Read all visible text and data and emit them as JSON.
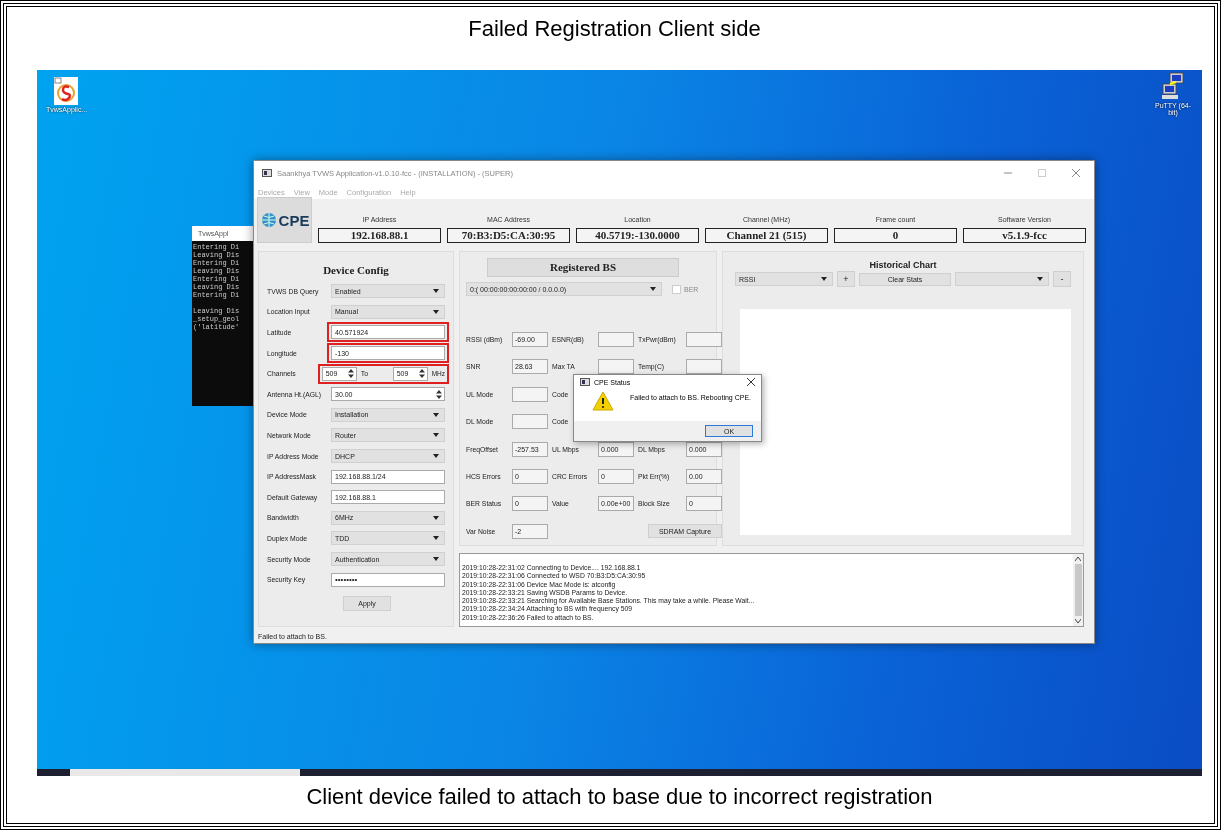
{
  "slide_title": "Failed Registration Client side",
  "caption": "Client device failed to attach to base due to incorrect registration",
  "desktop_icons": [
    {
      "kind": "app",
      "label": "TvwsApplic..."
    },
    {
      "kind": "putty",
      "label": "PuTTY (64-bit)"
    }
  ],
  "console": {
    "title": "TvwsAppl",
    "blocks": [
      [
        "Entering Di",
        "Leaving Dis",
        "Entering Di",
        "Leaving Dis",
        "Entering Di",
        "Leaving Dis",
        "Entering Di"
      ],
      [
        "Leaving Dis",
        "_setup_geol",
        "('latitude'"
      ]
    ]
  },
  "window": {
    "title": "Saankhya TVWS Application-v1.0.10-fcc - (INSTALLATION) - (SUPER)",
    "menu": [
      {
        "label": "Devices",
        "disabled": true
      },
      {
        "label": "View",
        "disabled": true
      },
      {
        "label": "Mode",
        "disabled": true
      },
      {
        "label": "Configuration",
        "disabled": true
      },
      {
        "label": "Help",
        "disabled": true
      }
    ],
    "logo_text": "CPE",
    "info": [
      {
        "label": "IP Address",
        "value": "192.168.88.1"
      },
      {
        "label": "MAC Address",
        "value": "70:B3:D5:CA:30:95"
      },
      {
        "label": "Location",
        "value": "40.5719:-130.0000"
      },
      {
        "label": "Channel (MHz)",
        "value": "Channel 21 (515)"
      },
      {
        "label": "Frame count",
        "value": "0"
      },
      {
        "label": "Software Version",
        "value": "v5.1.9-fcc"
      }
    ],
    "device_config": {
      "title": "Device Config",
      "rows": [
        {
          "kind": "select",
          "label": "TVWS DB Query",
          "value": "Enabled",
          "highlighted": false
        },
        {
          "kind": "select",
          "label": "Location Input",
          "value": "Manual",
          "highlighted": false
        },
        {
          "kind": "text",
          "label": "Latitude",
          "value": "40.571924",
          "highlighted": true
        },
        {
          "kind": "text",
          "label": "Longitude",
          "value": "-130",
          "highlighted": true
        },
        {
          "kind": "range",
          "label": "Channels",
          "from": "509",
          "to_label": "To",
          "to": "509",
          "unit": "MHz",
          "highlighted": true
        },
        {
          "kind": "spin",
          "label": "Antenna Ht.(AGL)",
          "value": "30.00",
          "highlighted": false
        },
        {
          "kind": "select",
          "label": "Device Mode",
          "value": "Installation",
          "highlighted": false
        },
        {
          "kind": "select",
          "label": "Network Mode",
          "value": "Router",
          "highlighted": false
        },
        {
          "kind": "select",
          "label": "IP Address Mode",
          "value": "DHCP",
          "highlighted": false
        },
        {
          "kind": "text",
          "label": "IP AddressMask",
          "value": "192.168.88.1/24",
          "highlighted": false
        },
        {
          "kind": "text",
          "label": "Default Gateway",
          "value": "192.168.88.1",
          "highlighted": false
        },
        {
          "kind": "select",
          "label": "Bandwidth",
          "value": "6MHz",
          "highlighted": false
        },
        {
          "kind": "select",
          "label": "Duplex Mode",
          "value": "TDD",
          "highlighted": false
        },
        {
          "kind": "select",
          "label": "Security Mode",
          "value": "Authentication",
          "highlighted": false
        },
        {
          "kind": "password",
          "label": "Security Key",
          "value": "••••••••",
          "highlighted": false
        }
      ],
      "apply": "Apply"
    },
    "registered_bs": {
      "title": "Registered BS",
      "select": "0:( 00:00:00:00:00:00 / 0.0.0.0)",
      "ber": {
        "label": "BER",
        "checked": false,
        "disabled": true
      },
      "rows": [
        [
          {
            "label": "RSSI (dBm)",
            "value": "-69.00",
            "field": true
          },
          {
            "label": "ESNR(dB)",
            "field": true
          },
          {
            "label": "TxPwr(dBm)",
            "field": true
          }
        ],
        [
          {
            "label": "SNR",
            "value": "28.63",
            "field": true
          },
          {
            "label": "Max TA",
            "field": true
          },
          {
            "label": "Temp(C)",
            "field": true
          }
        ],
        [
          {
            "label": "UL Mode",
            "field": true
          },
          {
            "label": "Code",
            "field": false
          }
        ],
        [
          {
            "label": "DL Mode",
            "field": true
          },
          {
            "label": "Code",
            "field": false
          }
        ],
        [
          {
            "label": "FreqOffset",
            "value": "-257.53",
            "field": true
          },
          {
            "label": "UL Mbps",
            "value": "0.000",
            "field": true
          },
          {
            "label": "DL Mbps",
            "value": "0.000",
            "field": true
          }
        ],
        [
          {
            "label": "HCS Errors",
            "value": "0",
            "field": true
          },
          {
            "label": "CRC Errors",
            "value": "0",
            "field": true
          },
          {
            "label": "Pkt Err(%)",
            "value": "0.00",
            "field": true
          }
        ],
        [
          {
            "label": "BER Status",
            "value": "0",
            "field": true
          },
          {
            "label": "Value",
            "value": "0.00e+00",
            "field": true
          },
          {
            "label": "Block Size",
            "value": "0",
            "field": true
          }
        ],
        [
          {
            "label": "Var Noise",
            "value": "-2",
            "field": true
          }
        ]
      ],
      "capture_button": "SDRAM Capture"
    },
    "chart": {
      "title": "Historical Chart",
      "metric": "RSSI",
      "add": "+",
      "clear": "Clear Stats",
      "remove": "-"
    },
    "log": [
      "2019:10:28-22:31:02 Connecting to Device.... 192.168.88.1",
      "2019:10:28-22:31:06 Connected to WSD 70:B3:D5:CA:30:95",
      "2019:10:28-22:31:06 Device Mac Mode is: atconfig",
      "2019:10:28-22:33:21 Saving WSDB Params to Device.",
      "2019:10:28-22:33:21 Searching for Available Base Stations. This may take a while. Please Wait...",
      "2019:10:28-22:34:24 Attaching to BS with frequency 509",
      "2019:10:28-22:36:26 Failed to attach to BS."
    ],
    "status_bar": "Failed to attach to BS."
  },
  "dialog": {
    "title": "CPE Status",
    "message": "Failed to attach to BS. Rebooting CPE.",
    "button": "OK"
  }
}
